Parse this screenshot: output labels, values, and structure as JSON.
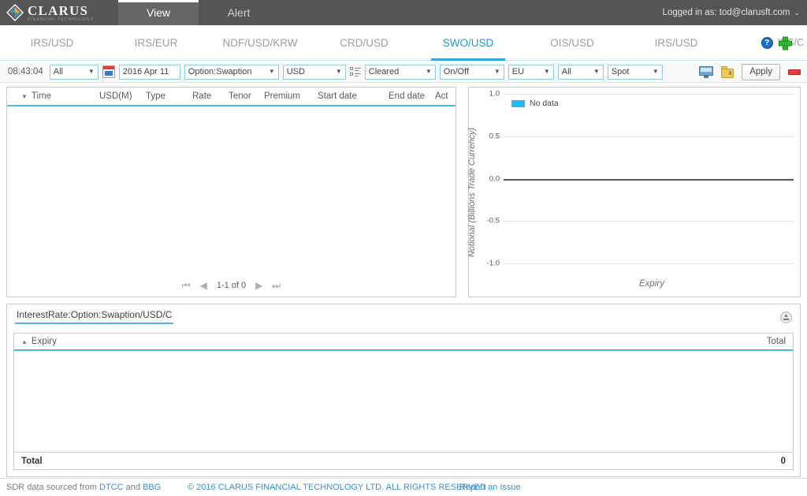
{
  "topbar": {
    "logo_main": "CLARUS",
    "logo_sub": "FINANCIAL TECHNOLOGY",
    "nav": [
      {
        "label": "View",
        "active": true
      },
      {
        "label": "Alert",
        "active": false
      }
    ],
    "login_text": "Logged in as: tod@clarusft.com",
    "login_caret": "⌄"
  },
  "tabs": {
    "items": [
      {
        "label": "IRS/USD"
      },
      {
        "label": "IRS/EUR"
      },
      {
        "label": "NDF/USD/KRW"
      },
      {
        "label": "CRD/USD"
      },
      {
        "label": "SWO/USD"
      },
      {
        "label": "OIS/USD"
      },
      {
        "label": "IRS/USD"
      }
    ],
    "active_index": 4,
    "help_glyph": "?",
    "add_tab_label": "IRS/C"
  },
  "toolbar": {
    "clock": "08:43:04",
    "scope": "All",
    "date": "2016 Apr 11",
    "product": "Option:Swaption",
    "currency": "USD",
    "cleared": "Cleared",
    "onoff": "On/Off",
    "venue": "EU",
    "all2": "All",
    "spot": "Spot",
    "apply_label": "Apply",
    "arrow_glyph": "▼"
  },
  "trades": {
    "columns": [
      {
        "label": "Time",
        "x": 32,
        "sorted": true
      },
      {
        "label": "USD(M)",
        "x": 125
      },
      {
        "label": "Type",
        "x": 186
      },
      {
        "label": "Rate",
        "x": 243
      },
      {
        "label": "Tenor",
        "x": 290
      },
      {
        "label": "Premium",
        "x": 336
      },
      {
        "label": "Start date",
        "x": 398
      },
      {
        "label": "End date",
        "x": 487
      },
      {
        "label": "Act",
        "x": 548
      }
    ],
    "sort_caret": "▼",
    "rows": [],
    "pager": {
      "first": "⏮",
      "prev": "◀",
      "label": "1-1 of 0",
      "next": "▶",
      "last": "⏭"
    }
  },
  "chart_data": {
    "type": "bar",
    "title": "",
    "xlabel": "Expiry",
    "ylabel": "Notional (Billions Trade Currency)",
    "categories": [],
    "values": [],
    "series": [
      {
        "name": "No data",
        "color": "#29b6f6",
        "values": []
      }
    ],
    "yticks": [
      "1.0",
      "0.5",
      "0.0",
      "-0.5",
      "-1.0"
    ],
    "ylim": [
      -1.0,
      1.0
    ],
    "grid": true,
    "legend_position": "top-left",
    "legend_label": "No data"
  },
  "aggregate": {
    "title": "InterestRate:Option:Swaption/USD/C",
    "columns": [
      {
        "label": "Expiry",
        "sorted": true
      },
      {
        "label": "Total"
      }
    ],
    "sort_caret": "▲",
    "rows": [],
    "total_label": "Total",
    "total_value": "0"
  },
  "footer": {
    "left_prefix": "SDR data sourced from ",
    "left_link1": "DTCC",
    "left_mid": " and ",
    "left_link2": "BBG",
    "copyright": "© 2016 CLARUS FINANCIAL TECHNOLOGY LTD. ALL RIGHTS RESERVED",
    "report_link": "Report an Issue"
  }
}
